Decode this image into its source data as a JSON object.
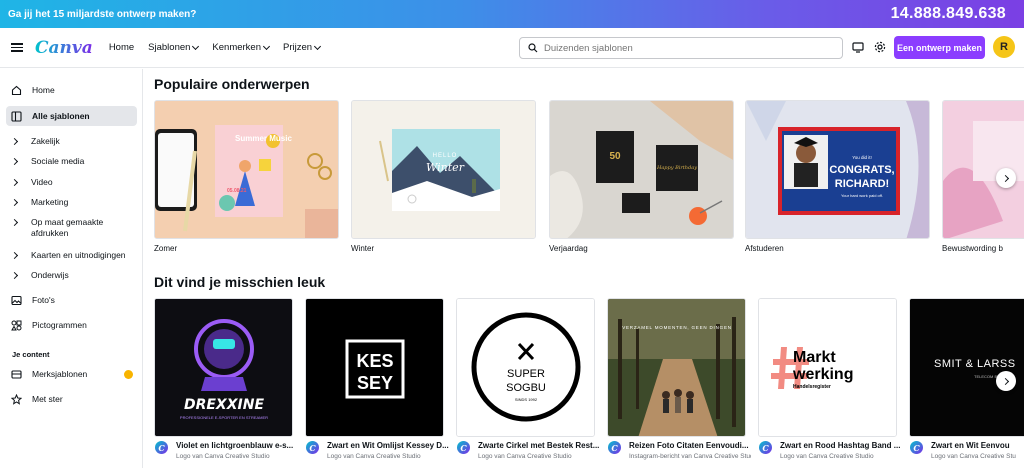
{
  "banner": {
    "question": "Ga jij het 15 miljardste ontwerp maken?",
    "counter": "14.888.849.638"
  },
  "header": {
    "logo": "Canva",
    "nav": [
      "Home",
      "Sjablonen",
      "Kenmerken",
      "Prijzen"
    ],
    "search_placeholder": "Duizenden sjablonen",
    "cta": "Een ontwerp maken",
    "avatar_initial": "R"
  },
  "sidebar": {
    "home": "Home",
    "all_templates": "Alle sjablonen",
    "categories": [
      "Zakelijk",
      "Sociale media",
      "Video",
      "Marketing",
      "Op maat gemaakte afdrukken",
      "Kaarten en uitnodigingen",
      "Onderwijs"
    ],
    "photos": "Foto's",
    "pictograms": "Pictogrammen",
    "section_label": "Je content",
    "brand_templates": "Merksjablonen",
    "starred": "Met ster"
  },
  "popular": {
    "title": "Populaire onderwerpen",
    "items": [
      "Zomer",
      "Winter",
      "Verjaardag",
      "Afstuderen",
      "Bewustwording b"
    ]
  },
  "suggested": {
    "title": "Dit vind je misschien leuk",
    "items": [
      {
        "name": "Violet en lichtgroenblauw e-s...",
        "sub": "Logo van Canva Creative Studio",
        "art": "DREXXINE",
        "art_sub": "PROFESSIONELE E-SPORTER EN STREAMER"
      },
      {
        "name": "Zwart en Wit Omlijst Kessey D...",
        "sub": "Logo van Canva Creative Studio",
        "art1": "KES",
        "art2": "SEY"
      },
      {
        "name": "Zwarte Cirkel met Bestek Rest...",
        "sub": "Logo van Canva Creative Studio",
        "art1": "SUPER",
        "art2": "SOGBU",
        "art3": "SINDS 1992"
      },
      {
        "name": "Reizen Foto Citaten Eenvoudi...",
        "sub": "Instagram-bericht van Canva Creative Studio",
        "art": "VERZAMEL MOMENTEN, GEEN DINGEN"
      },
      {
        "name": "Zwart en Rood Hashtag Band ...",
        "sub": "Logo van Canva Creative Studio",
        "art1": "Markt",
        "art2": "werking",
        "art3": "Handelsregister"
      },
      {
        "name": "Zwart en Wit Eenvou",
        "sub": "Logo van Canva Creative Stu",
        "art": "SMIT & LARSS",
        "art_sub": "TELECOM BV"
      }
    ]
  },
  "popular_art": {
    "summer_title": "Summer Music",
    "summer_date": "05.08.21",
    "winter_line1": "HELLO",
    "winter_line2": "Winter",
    "bday_num": "50",
    "bday_text": "Happy Birthday",
    "grad_small": "You did it!",
    "grad_big1": "CONGRATS,",
    "grad_big2": "RICHARD!",
    "grad_foot": "Your hard work paid off."
  }
}
